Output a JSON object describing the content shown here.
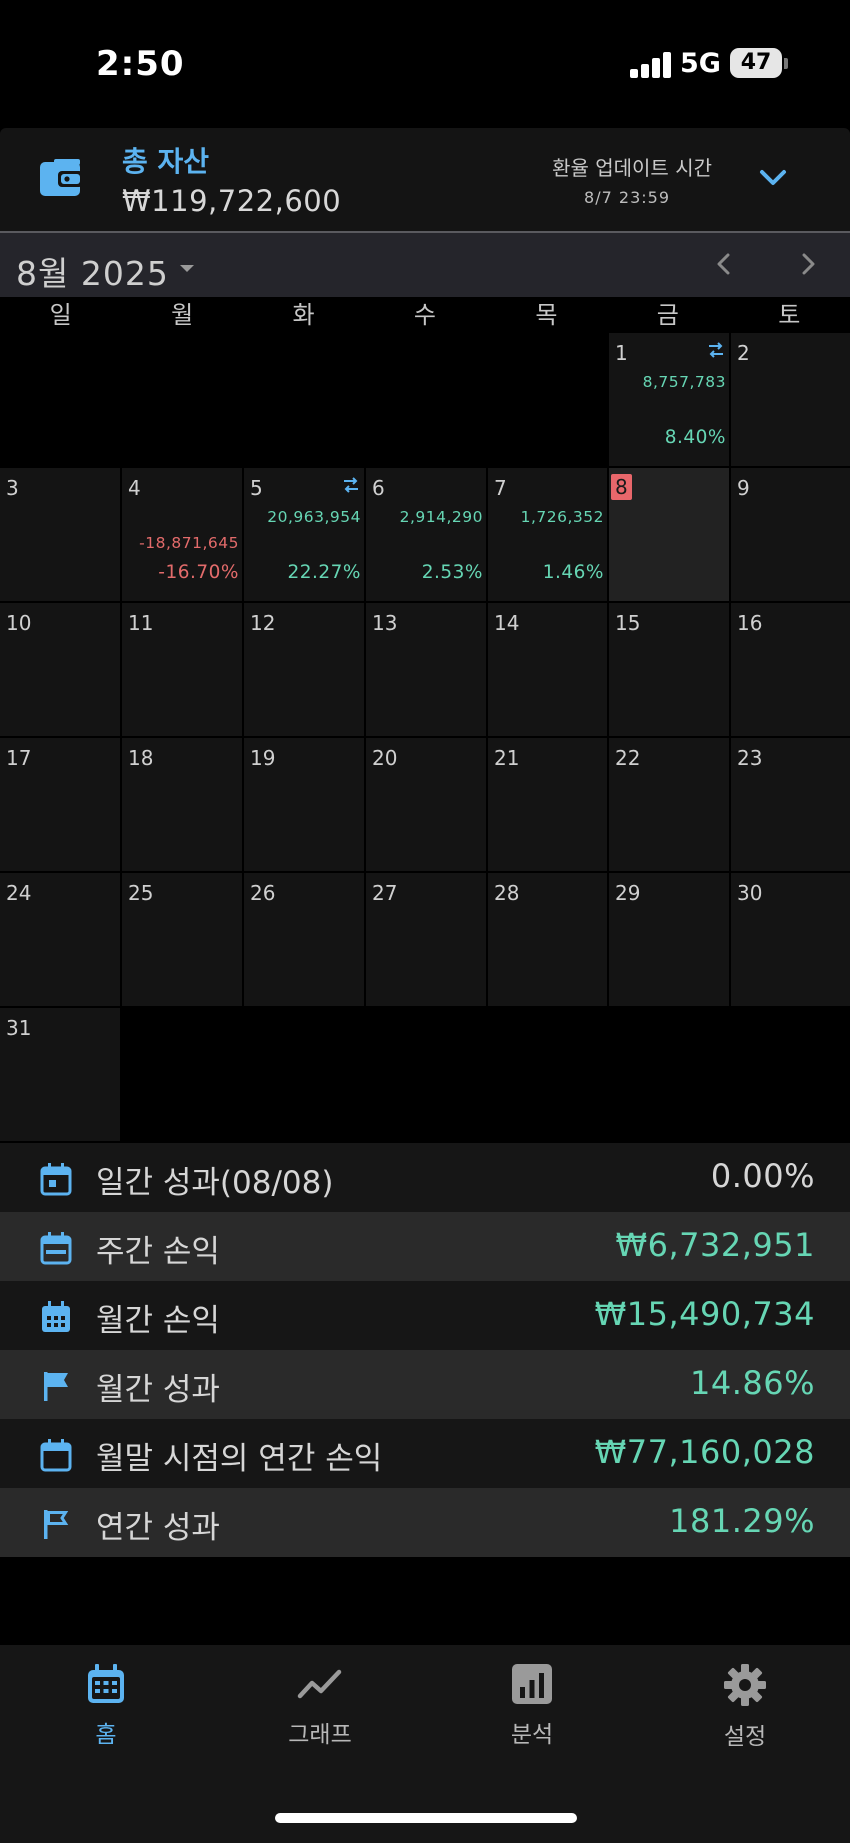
{
  "status": {
    "time": "2:50",
    "network": "5G",
    "battery": "47"
  },
  "header": {
    "label": "총 자산",
    "value": "₩119,722,600",
    "fx_title": "환율 업데이트 시간",
    "fx_time": "8/7 23:59"
  },
  "calendar": {
    "month_label": "8월 2025",
    "weekdays": [
      "일",
      "월",
      "화",
      "수",
      "목",
      "금",
      "토"
    ],
    "days": {
      "d1": {
        "num": "1",
        "amount": "8,757,783",
        "pct": "8.40%"
      },
      "d2": {
        "num": "2"
      },
      "d3": {
        "num": "3"
      },
      "d4": {
        "num": "4",
        "amount": "-18,871,645",
        "pct": "-16.70%"
      },
      "d5": {
        "num": "5",
        "amount": "20,963,954",
        "pct": "22.27%"
      },
      "d6": {
        "num": "6",
        "amount": "2,914,290",
        "pct": "2.53%"
      },
      "d7": {
        "num": "7",
        "amount": "1,726,352",
        "pct": "1.46%"
      },
      "d8": {
        "num": "8"
      },
      "d9": {
        "num": "9"
      },
      "d10": {
        "num": "10"
      },
      "d11": {
        "num": "11"
      },
      "d12": {
        "num": "12"
      },
      "d13": {
        "num": "13"
      },
      "d14": {
        "num": "14"
      },
      "d15": {
        "num": "15"
      },
      "d16": {
        "num": "16"
      },
      "d17": {
        "num": "17"
      },
      "d18": {
        "num": "18"
      },
      "d19": {
        "num": "19"
      },
      "d20": {
        "num": "20"
      },
      "d21": {
        "num": "21"
      },
      "d22": {
        "num": "22"
      },
      "d23": {
        "num": "23"
      },
      "d24": {
        "num": "24"
      },
      "d25": {
        "num": "25"
      },
      "d26": {
        "num": "26"
      },
      "d27": {
        "num": "27"
      },
      "d28": {
        "num": "28"
      },
      "d29": {
        "num": "29"
      },
      "d30": {
        "num": "30"
      },
      "d31": {
        "num": "31"
      }
    }
  },
  "summary": [
    {
      "label": "일간 성과(08/08)",
      "value": "0.00%",
      "icon": "calendar-day-icon"
    },
    {
      "label": "주간 손익",
      "value": "₩6,732,951",
      "icon": "calendar-week-icon"
    },
    {
      "label": "월간 손익",
      "value": "₩15,490,734",
      "icon": "calendar-month-icon"
    },
    {
      "label": "월간 성과",
      "value": "14.86%",
      "icon": "flag-filled-icon"
    },
    {
      "label": "월말 시점의 연간 손익",
      "value": "₩77,160,028",
      "icon": "calendar-blank-icon"
    },
    {
      "label": "연간 성과",
      "value": "181.29%",
      "icon": "flag-outline-icon"
    }
  ],
  "tabs": [
    {
      "label": "홈",
      "icon": "calendar-icon"
    },
    {
      "label": "그래프",
      "icon": "line-chart-icon"
    },
    {
      "label": "분석",
      "icon": "bar-chart-icon"
    },
    {
      "label": "설정",
      "icon": "gear-icon"
    }
  ],
  "colors": {
    "accent": "#5cb3f0",
    "positive": "#66d6b4",
    "negative": "#e36b6b",
    "today": "#e9676b"
  }
}
